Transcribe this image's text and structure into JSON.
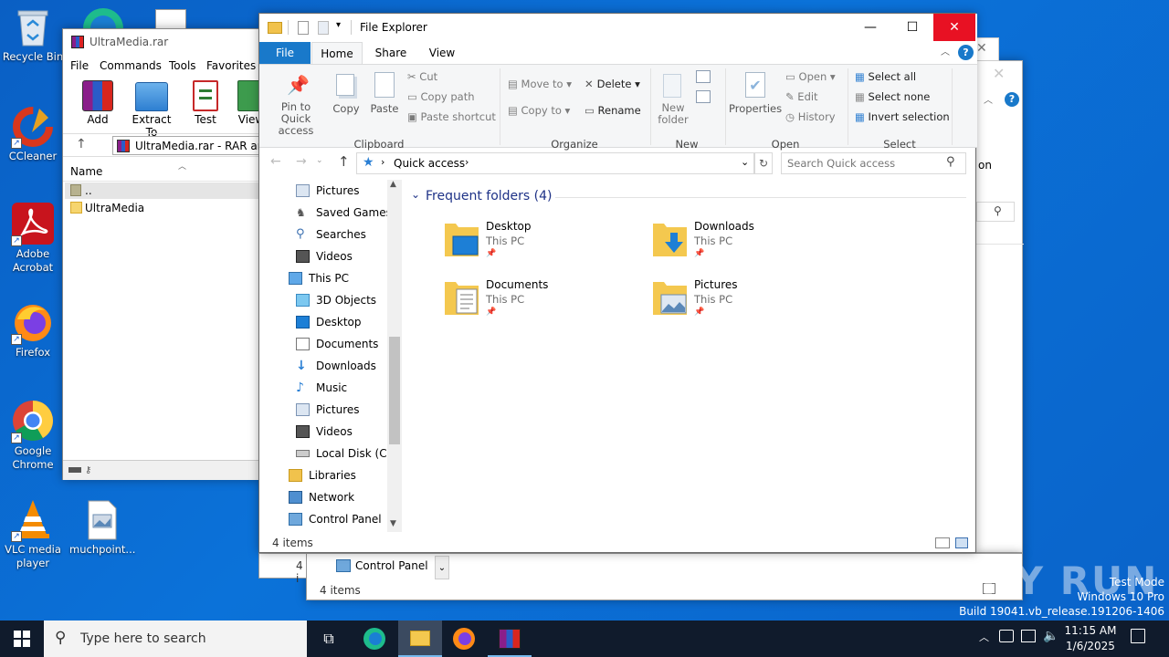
{
  "desktop": {
    "icons": [
      {
        "label": "Recycle Bin"
      },
      {
        "label": "CCleaner"
      },
      {
        "label": "Adobe Acrobat"
      },
      {
        "label": "Firefox"
      },
      {
        "label": "Google Chrome"
      },
      {
        "label": "VLC media player"
      },
      {
        "label": "muchpoint..."
      }
    ]
  },
  "winrar": {
    "title": "UltraMedia.rar",
    "menu": [
      "File",
      "Commands",
      "Tools",
      "Favorites"
    ],
    "toolbar": [
      "Add",
      "Extract To",
      "Test",
      "View"
    ],
    "path": "UltraMedia.rar - RAR arch",
    "column": "Name",
    "rows": [
      "..",
      "UltraMedia"
    ]
  },
  "explorer": {
    "title": "File Explorer",
    "tabs": [
      "File",
      "Home",
      "Share",
      "View"
    ],
    "ribbon": {
      "clipboard": {
        "pin": "Pin to Quick access",
        "copy": "Copy",
        "paste": "Paste",
        "cut": "Cut",
        "copy_path": "Copy path",
        "paste_shortcut": "Paste shortcut",
        "group": "Clipboard"
      },
      "organize": {
        "move_to": "Move to",
        "copy_to": "Copy to",
        "delete": "Delete",
        "rename": "Rename",
        "group": "Organize"
      },
      "new": {
        "new_folder": "New folder",
        "group": "New"
      },
      "open": {
        "properties": "Properties",
        "open": "Open",
        "edit": "Edit",
        "history": "History",
        "group": "Open"
      },
      "select": {
        "select_all": "Select all",
        "select_none": "Select none",
        "invert": "Invert selection",
        "group": "Select"
      }
    },
    "address": "Quick access",
    "search_placeholder": "Search Quick access",
    "nav": [
      "Pictures",
      "Saved Games",
      "Searches",
      "Videos",
      "This PC",
      "3D Objects",
      "Desktop",
      "Documents",
      "Downloads",
      "Music",
      "Pictures",
      "Videos",
      "Local Disk (C:)",
      "Libraries",
      "Network",
      "Control Panel"
    ],
    "section": "Frequent folders (4)",
    "folders": [
      {
        "name": "Desktop",
        "location": "This PC"
      },
      {
        "name": "Downloads",
        "location": "This PC"
      },
      {
        "name": "Documents",
        "location": "This PC"
      },
      {
        "name": "Pictures",
        "location": "This PC"
      }
    ],
    "status": "4 items"
  },
  "back_window": {
    "partial_text": "on",
    "status_partial": "4 i",
    "status": "4 items",
    "control_panel": "Control Panel"
  },
  "watermark": {
    "brand": "ANY RUN",
    "line1": "Test Mode",
    "line2": "Windows 10 Pro",
    "line3": "Build 19041.vb_release.191206-1406"
  },
  "taskbar": {
    "search_placeholder": "Type here to search",
    "time": "11:15 AM",
    "date": "1/6/2025"
  },
  "colors": {
    "desktop": "#0b6fd6",
    "accent": "#1979ca",
    "close": "#e81123"
  }
}
